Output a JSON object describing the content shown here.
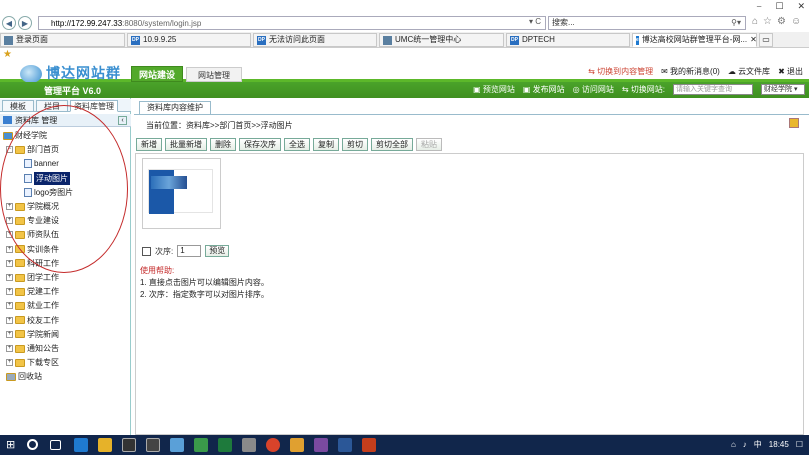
{
  "browser": {
    "url_host": "http://172.99.247.33",
    "url_path": ":8080/system/login.jsp",
    "addr_controls": "▾ C",
    "search_placeholder": "搜索...",
    "window_controls": [
      "⎯",
      "☐",
      "✕"
    ],
    "tabs": [
      {
        "label": "登录页面",
        "icon": "page-icon"
      },
      {
        "label": "10.9.9.25",
        "icon": "dp-icon"
      },
      {
        "label": "无法访问此页面",
        "icon": "dp-icon"
      },
      {
        "label": "UMC统一管理中心",
        "icon": "page-icon"
      },
      {
        "label": "DPTECH",
        "icon": "dp-icon"
      },
      {
        "label": "博达高校网站群管理平台-网...",
        "icon": "ie-icon",
        "active": true
      }
    ]
  },
  "app": {
    "logo": "博达网站群",
    "platform": "管理平台  V6.0",
    "main_tabs": [
      "网站建设",
      "网站管理"
    ],
    "top_links": [
      "切换到内容管理",
      "我的新消息(0)",
      "云文件库",
      "退出"
    ],
    "green_links": [
      "预览网站",
      "发布网站",
      "访问网站",
      "切换网站:"
    ],
    "search_placeholder": "请输入关键字查询",
    "site_select": "财经学院"
  },
  "left": {
    "tabs": [
      "模板",
      "栏目",
      "资料库管理"
    ],
    "header": "资料库 管理",
    "tree": [
      {
        "label": "财经学院",
        "level": 0,
        "type": "root"
      },
      {
        "label": "部门首页",
        "level": 1,
        "type": "folder",
        "exp": "−"
      },
      {
        "label": "banner",
        "level": 2,
        "type": "doc"
      },
      {
        "label": "浮动图片",
        "level": 2,
        "type": "doc",
        "selected": true
      },
      {
        "label": "logo旁图片",
        "level": 2,
        "type": "doc"
      },
      {
        "label": "学院概况",
        "level": 1,
        "type": "folder",
        "exp": "+"
      },
      {
        "label": "专业建设",
        "level": 1,
        "type": "folder",
        "exp": "+"
      },
      {
        "label": "师资队伍",
        "level": 1,
        "type": "folder",
        "exp": "+"
      },
      {
        "label": "实训条件",
        "level": 1,
        "type": "folder",
        "exp": "+"
      },
      {
        "label": "科研工作",
        "level": 1,
        "type": "folder",
        "exp": "+"
      },
      {
        "label": "团学工作",
        "level": 1,
        "type": "folder",
        "exp": "+"
      },
      {
        "label": "党建工作",
        "level": 1,
        "type": "folder",
        "exp": "+"
      },
      {
        "label": "就业工作",
        "level": 1,
        "type": "folder",
        "exp": "+"
      },
      {
        "label": "校友工作",
        "level": 1,
        "type": "folder",
        "exp": "+"
      },
      {
        "label": "学院新闻",
        "level": 1,
        "type": "folder",
        "exp": "+"
      },
      {
        "label": "通知公告",
        "level": 1,
        "type": "folder",
        "exp": "+"
      },
      {
        "label": "下载专区",
        "level": 1,
        "type": "folder",
        "exp": "+"
      },
      {
        "label": "回收站",
        "level": 1,
        "type": "recycle"
      }
    ]
  },
  "content": {
    "tab": "资料库内容维护",
    "breadcrumb": "当前位置：资料库>>部门首页>>浮动图片",
    "toolbar": [
      {
        "label": "新增"
      },
      {
        "label": "批量新增"
      },
      {
        "label": "删除"
      },
      {
        "label": "保存次序"
      },
      {
        "label": "全选"
      },
      {
        "label": "复制"
      },
      {
        "label": "剪切"
      },
      {
        "label": "剪切全部"
      },
      {
        "label": "粘贴",
        "disabled": true
      }
    ],
    "order_label": "次序:",
    "order_value": "1",
    "preview_button": "预览",
    "help_title": "使用帮助:",
    "help_lines": [
      "1. 直接点击图片可以编辑图片内容。",
      "2. 次序：指定数字可以对图片排序。"
    ]
  },
  "taskbar": {
    "time": "18:45"
  }
}
